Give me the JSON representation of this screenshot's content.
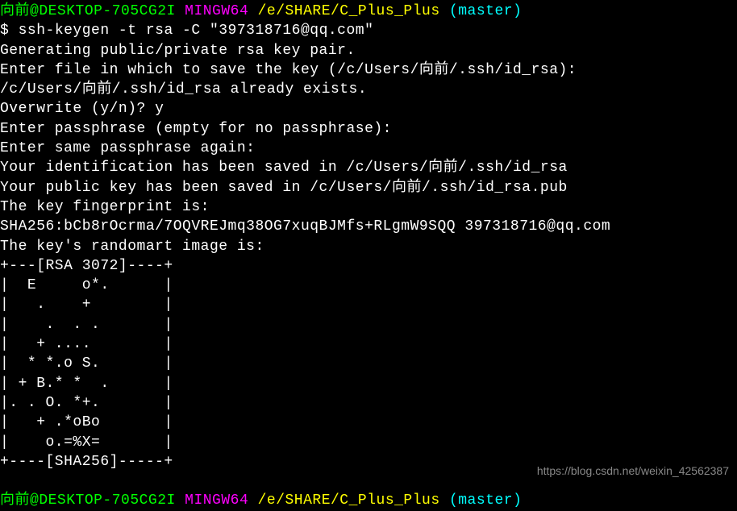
{
  "prompt1": {
    "user": "向前",
    "at": "@",
    "host": "DESKTOP-705CG2I",
    "shell": "MINGW64",
    "path": "/e/SHARE/C_Plus_Plus",
    "branch": "(master)"
  },
  "command": {
    "prefix": "$ ",
    "text": "ssh-keygen -t rsa -C \"397318716@qq.com\""
  },
  "output": {
    "line1": "Generating public/private rsa key pair.",
    "line2": "Enter file in which to save the key (/c/Users/向前/.ssh/id_rsa):",
    "line3": "/c/Users/向前/.ssh/id_rsa already exists.",
    "line4": "Overwrite (y/n)? y",
    "line5": "Enter passphrase (empty for no passphrase):",
    "line6": "Enter same passphrase again:",
    "line7": "Your identification has been saved in /c/Users/向前/.ssh/id_rsa",
    "line8": "Your public key has been saved in /c/Users/向前/.ssh/id_rsa.pub",
    "line9": "The key fingerprint is:",
    "line10": "SHA256:bCb8rOcrma/7OQVREJmq38OG7xuqBJMfs+RLgmW9SQQ 397318716@qq.com",
    "line11": "The key's randomart image is:",
    "art1": "+---[RSA 3072]----+",
    "art2": "|  E     o*.      |",
    "art3": "|   .    +        |",
    "art4": "|    .  . .       |",
    "art5": "|   + ....        |",
    "art6": "|  * *.o S.       |",
    "art7": "| + B.* *  .      |",
    "art8": "|. . O. *+.       |",
    "art9": "|   + .*oBo       |",
    "art10": "|    o.=%X=       |",
    "art11": "+----[SHA256]-----+"
  },
  "prompt2": {
    "user": "向前",
    "at": "@",
    "host": "DESKTOP-705CG2I",
    "shell": "MINGW64",
    "path": "/e/SHARE/C_Plus_Plus",
    "branch": "(master)"
  },
  "watermark": "https://blog.csdn.net/weixin_42562387"
}
